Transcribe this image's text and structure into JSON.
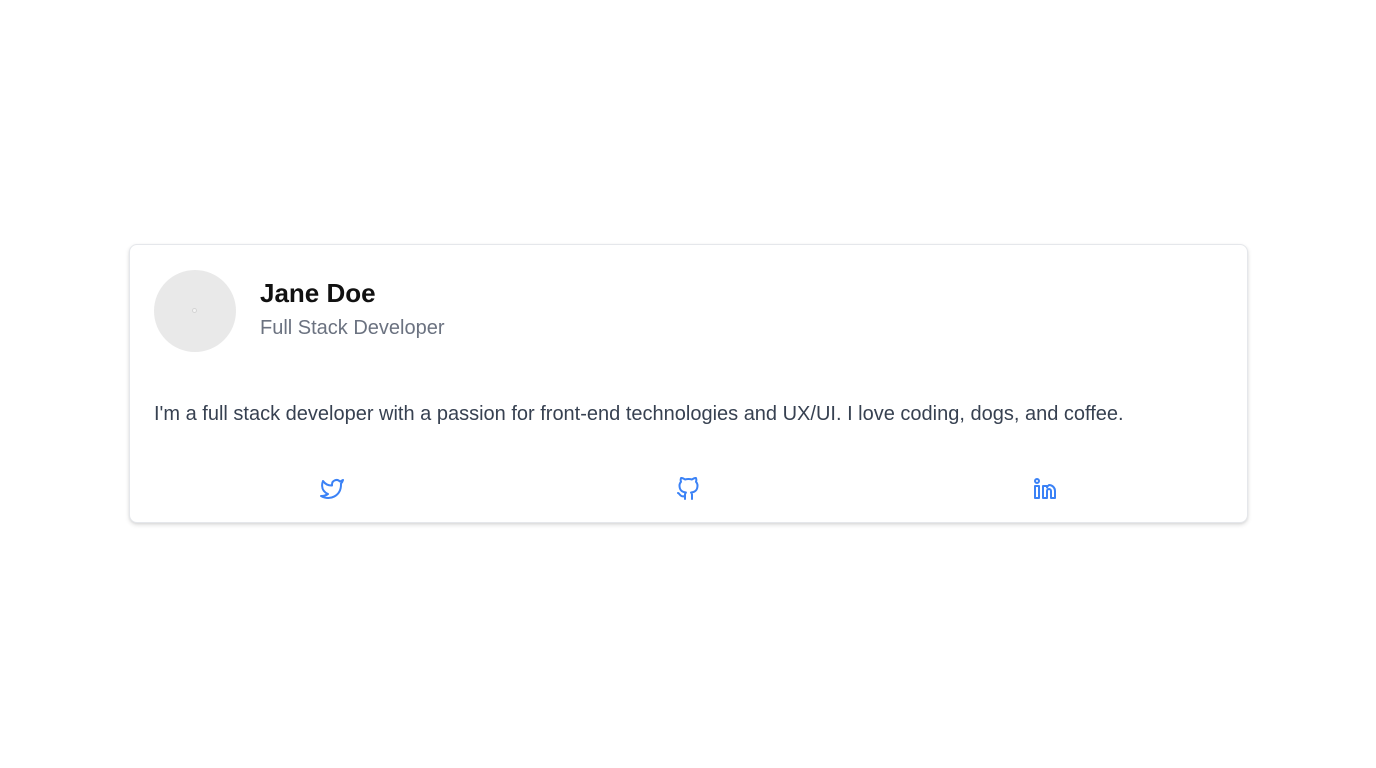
{
  "profile": {
    "name": "Jane Doe",
    "title": "Full Stack Developer",
    "bio": "I'm a full stack developer with a passion for front-end technologies and UX/UI. I love coding, dogs, and coffee."
  },
  "social": [
    {
      "icon": "twitter-icon"
    },
    {
      "icon": "github-icon"
    },
    {
      "icon": "linkedin-icon"
    }
  ],
  "colors": {
    "accent": "#3b82f6",
    "name_text": "#111111",
    "muted_text": "#6b7280",
    "body_text": "#374151",
    "avatar_bg": "#e9e9e9",
    "card_border": "#e5e7eb"
  }
}
